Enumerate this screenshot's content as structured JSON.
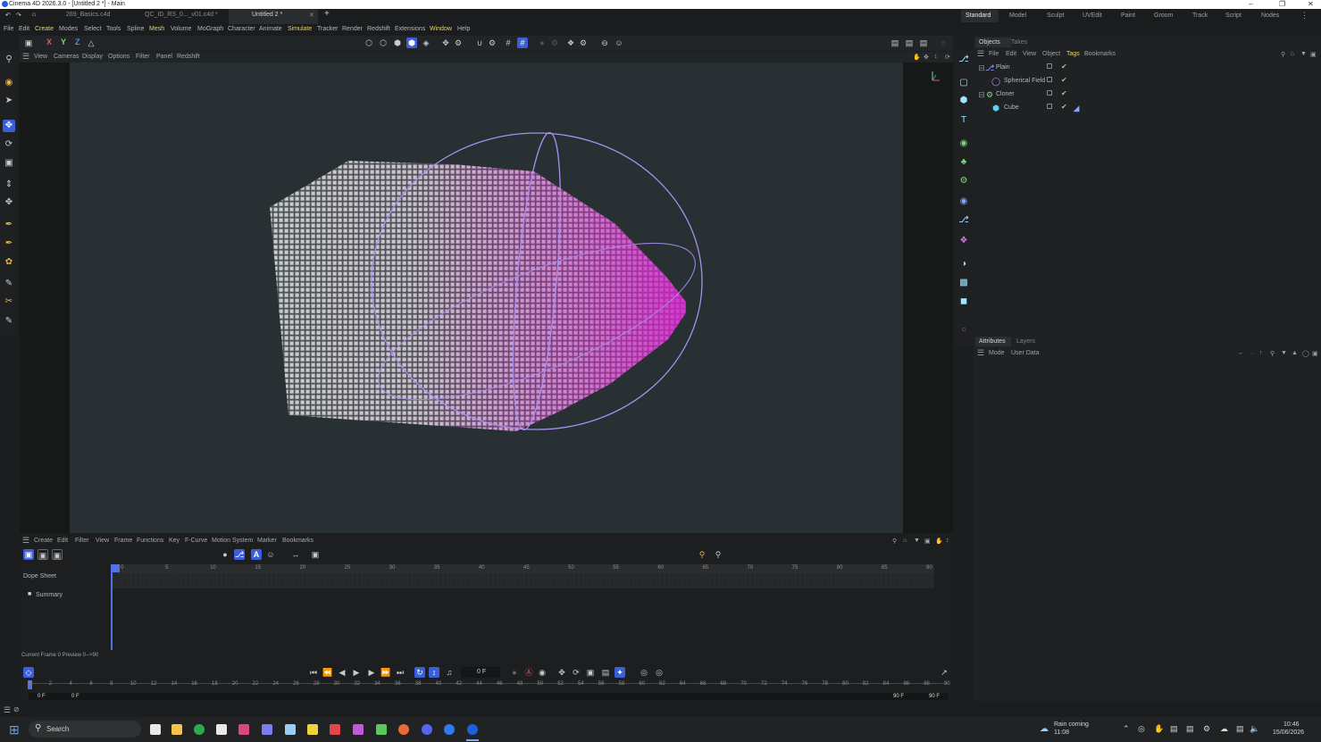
{
  "window": {
    "title": "Cinema 4D 2026.3.0 - [Untitled 2 *] - Main"
  },
  "tabs": [
    {
      "label": "269_Basics.c4d"
    },
    {
      "label": "QC_ID_RS_0..._v01.c4d *"
    },
    {
      "label": "Untitled 2 *"
    }
  ],
  "layouts": [
    "Standard",
    "Model",
    "Sculpt",
    "UVEdit",
    "Paint",
    "Groom",
    "Track",
    "Script",
    "Nodes"
  ],
  "menus": [
    "File",
    "Edit",
    "Create",
    "Modes",
    "Select",
    "Tools",
    "Spline",
    "Mesh",
    "Volume",
    "MoGraph",
    "Character",
    "Animate",
    "Simulate",
    "Tracker",
    "Render",
    "Redshift",
    "Extensions",
    "Window",
    "Help"
  ],
  "axes": {
    "x": "X",
    "y": "Y",
    "z": "Z"
  },
  "viewport_menu": [
    "View",
    "Cameras",
    "Display",
    "Options",
    "Filter",
    "Panel",
    "Redshift"
  ],
  "objects_panel": {
    "tabs": [
      "Objects",
      "Takes"
    ],
    "menu": [
      "File",
      "Edit",
      "View",
      "Object",
      "Tags",
      "Bookmarks"
    ],
    "rows": [
      {
        "name": "Plain"
      },
      {
        "name": "Spherical Field"
      },
      {
        "name": "Cloner"
      },
      {
        "name": "Cube"
      }
    ]
  },
  "attributes_panel": {
    "tabs": [
      "Attributes",
      "Layers"
    ],
    "menu": [
      "Mode",
      "User Data"
    ]
  },
  "timeline": {
    "menu": [
      "Create",
      "Edit",
      "Filter",
      "View",
      "Frame",
      "Functions",
      "Key",
      "F-Curve",
      "Motion System",
      "Marker",
      "Bookmarks"
    ],
    "dope_sheet": "Dope Sheet",
    "summary": "Summary",
    "ruler": [
      "0",
      "5",
      "10",
      "15",
      "20",
      "25",
      "30",
      "35",
      "40",
      "45",
      "50",
      "55",
      "60",
      "65",
      "70",
      "75",
      "80",
      "85",
      "90"
    ],
    "status": "Current Frame  0  Preview  0-->90"
  },
  "playback": {
    "current_frame": "0 F",
    "ruler": [
      "0",
      "2",
      "4",
      "6",
      "8",
      "10",
      "12",
      "14",
      "16",
      "18",
      "20",
      "22",
      "24",
      "26",
      "28",
      "30",
      "32",
      "34",
      "36",
      "38",
      "40",
      "42",
      "44",
      "46",
      "48",
      "50",
      "52",
      "54",
      "56",
      "58",
      "60",
      "62",
      "64",
      "66",
      "68",
      "70",
      "72",
      "74",
      "76",
      "78",
      "80",
      "82",
      "84",
      "86",
      "88",
      "90"
    ],
    "start_a": "0 F",
    "start_b": "0 F",
    "end_a": "90 F",
    "end_b": "90 F"
  },
  "taskbar": {
    "search": "Search",
    "weather_title": "Rain coming",
    "weather_time": "11:08",
    "clock_time": "10:46",
    "clock_date": "15/06/2026"
  },
  "colors": {
    "accent": "#3a5fd8",
    "highlight": "#e6d56a",
    "field": "#a88ff0",
    "magenta": "#d21fc9"
  }
}
